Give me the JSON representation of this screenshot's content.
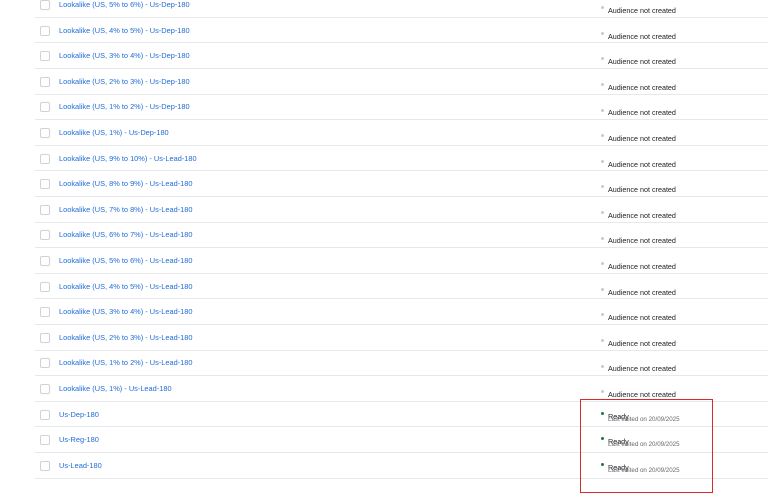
{
  "colors": {
    "link": "#1f6bd6",
    "ready_dot": "#1f7a3a",
    "not_created_dot": "#c8ccd2",
    "highlight": "#d92b2b"
  },
  "rows": [
    {
      "name": "Lookalike (US, 5% to 6%) - Us-Dep-180",
      "status": "Audience not created",
      "ready": false
    },
    {
      "name": "Lookalike (US, 4% to 5%) - Us-Dep-180",
      "status": "Audience not created",
      "ready": false
    },
    {
      "name": "Lookalike (US, 3% to 4%) - Us-Dep-180",
      "status": "Audience not created",
      "ready": false
    },
    {
      "name": "Lookalike (US, 2% to 3%) - Us-Dep-180",
      "status": "Audience not created",
      "ready": false
    },
    {
      "name": "Lookalike (US, 1% to 2%) - Us-Dep-180",
      "status": "Audience not created",
      "ready": false
    },
    {
      "name": "Lookalike (US, 1%) - Us-Dep-180",
      "status": "Audience not created",
      "ready": false
    },
    {
      "name": "Lookalike (US, 9% to 10%) - Us-Lead-180",
      "status": "Audience not created",
      "ready": false
    },
    {
      "name": "Lookalike (US, 8% to 9%) - Us-Lead-180",
      "status": "Audience not created",
      "ready": false
    },
    {
      "name": "Lookalike (US, 7% to 8%) - Us-Lead-180",
      "status": "Audience not created",
      "ready": false
    },
    {
      "name": "Lookalike (US, 6% to 7%) - Us-Lead-180",
      "status": "Audience not created",
      "ready": false
    },
    {
      "name": "Lookalike (US, 5% to 6%) - Us-Lead-180",
      "status": "Audience not created",
      "ready": false
    },
    {
      "name": "Lookalike (US, 4% to 5%) - Us-Lead-180",
      "status": "Audience not created",
      "ready": false
    },
    {
      "name": "Lookalike (US, 3% to 4%) - Us-Lead-180",
      "status": "Audience not created",
      "ready": false
    },
    {
      "name": "Lookalike (US, 2% to 3%) - Us-Lead-180",
      "status": "Audience not created",
      "ready": false
    },
    {
      "name": "Lookalike (US, 1% to 2%) - Us-Lead-180",
      "status": "Audience not created",
      "ready": false
    },
    {
      "name": "Lookalike (US, 1%) - Us-Lead-180",
      "status": "Audience not created",
      "ready": false
    },
    {
      "name": "Us-Dep-180",
      "status": "Ready",
      "ready": true,
      "sub": "Last edited on 20/09/2025"
    },
    {
      "name": "Us-Reg-180",
      "status": "Ready",
      "ready": true,
      "sub": "Last edited on 20/09/2025"
    },
    {
      "name": "Us-Lead-180",
      "status": "Ready",
      "ready": true,
      "sub": "Last edited on 20/09/2025"
    }
  ]
}
